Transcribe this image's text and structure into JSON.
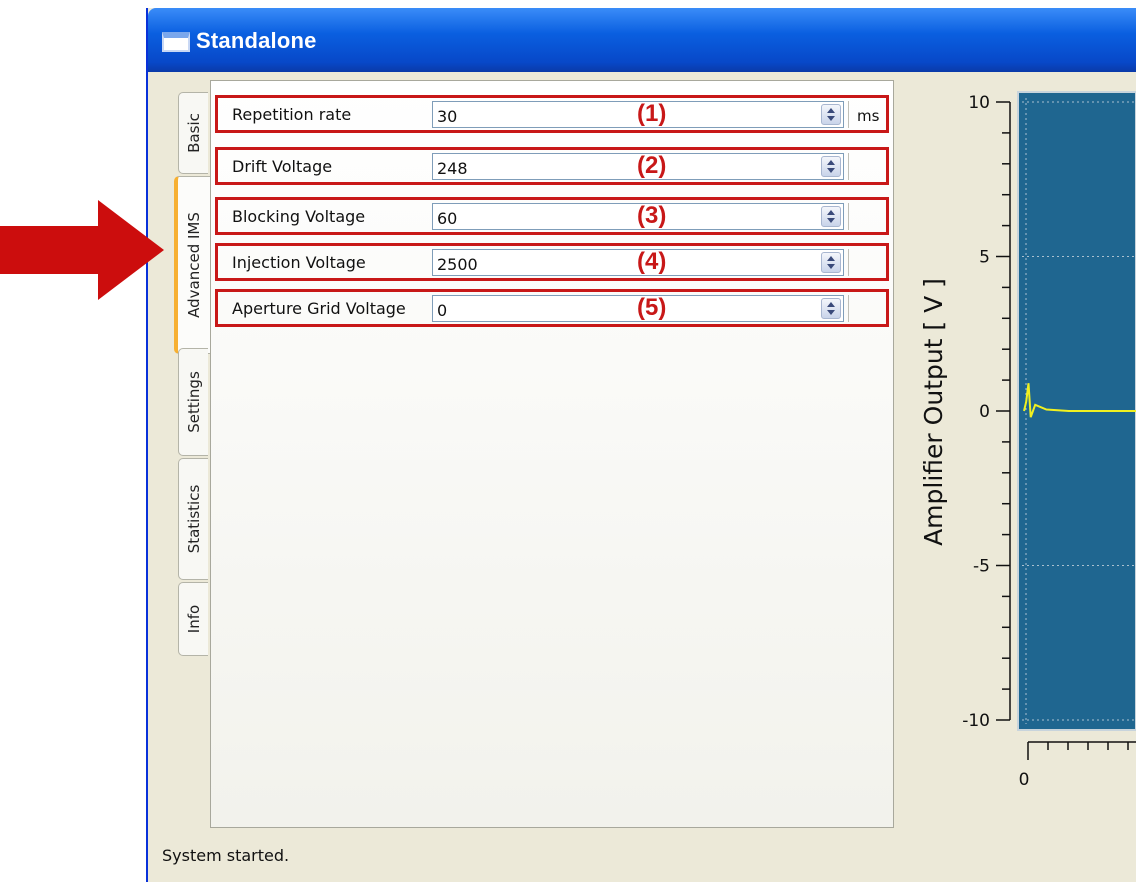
{
  "window": {
    "title": "Standalone"
  },
  "tabs": [
    {
      "label": "Basic",
      "active": false
    },
    {
      "label": "Advanced IMS",
      "active": true
    },
    {
      "label": "Settings",
      "active": false
    },
    {
      "label": "Statistics",
      "active": false
    },
    {
      "label": "Info",
      "active": false
    }
  ],
  "fields": [
    {
      "label": "Repetition rate",
      "value": "30",
      "number": "(1)",
      "unit": "ms"
    },
    {
      "label": "Drift Voltage",
      "value": "248",
      "number": "(2)",
      "unit": ""
    },
    {
      "label": "Blocking Voltage",
      "value": "60",
      "number": "(3)",
      "unit": ""
    },
    {
      "label": "Injection Voltage",
      "value": "2500",
      "number": "(4)",
      "unit": ""
    },
    {
      "label": "Aperture Grid Voltage",
      "value": "0",
      "number": "(5)",
      "unit": ""
    }
  ],
  "status": "System started.",
  "colors": {
    "annotation": "#c81818",
    "plot_bg": "#1f6690",
    "trace": "#f0f020"
  },
  "chart_data": {
    "type": "line",
    "ylabel": "Amplifier Output [ V ]",
    "y_ticks": [
      "10",
      "5",
      "0",
      "-5",
      "-10"
    ],
    "x_ticks": [
      "0"
    ],
    "ylim": [
      -10,
      10
    ],
    "series": [
      {
        "x": [
          0,
          0.02,
          0.04,
          0.06,
          0.1,
          0.2,
          0.4,
          0.6,
          0.8,
          1.0
        ],
        "y": [
          0,
          0.3,
          0.9,
          -0.2,
          0.2,
          0.05,
          0.0,
          0.0,
          0.0,
          0.0
        ]
      }
    ]
  }
}
